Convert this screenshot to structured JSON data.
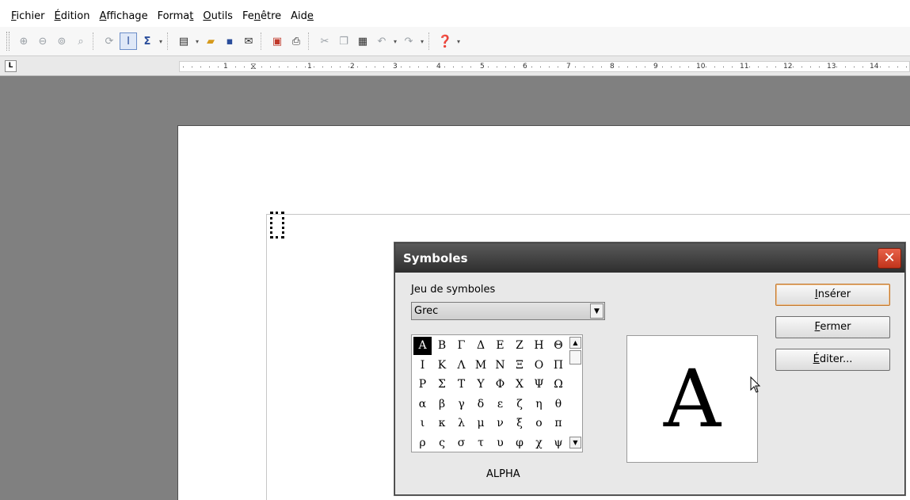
{
  "menu": [
    {
      "label": "Fichier",
      "key": "F",
      "rest": "ichier"
    },
    {
      "label": "Édition",
      "key": "É",
      "rest": "dition"
    },
    {
      "label": "Affichage",
      "key": "A",
      "rest": "ffichage"
    },
    {
      "label": "Format",
      "pre": "Forma",
      "key": "t"
    },
    {
      "label": "Outils",
      "key": "O",
      "rest": "utils"
    },
    {
      "label": "Fenêtre",
      "pre": "Fe",
      "key": "n",
      "rest": "être"
    },
    {
      "label": "Aide",
      "pre": "Aid",
      "key": "e"
    }
  ],
  "ruler": {
    "numbers": [
      "1",
      "1",
      "2",
      "3",
      "4",
      "5",
      "6",
      "7",
      "8",
      "9",
      "10",
      "11",
      "12",
      "13",
      "14"
    ]
  },
  "dialog": {
    "title": "Symboles",
    "set_label_key": "J",
    "set_label_rest": "eu de symboles",
    "selected_set": "Grec",
    "symbols": [
      [
        "Α",
        "Β",
        "Γ",
        "Δ",
        "Ε",
        "Ζ",
        "Η",
        "Θ"
      ],
      [
        "Ι",
        "Κ",
        "Λ",
        "Μ",
        "Ν",
        "Ξ",
        "Ο",
        "Π"
      ],
      [
        "Ρ",
        "Σ",
        "Τ",
        "Υ",
        "Φ",
        "Χ",
        "Ψ",
        "Ω"
      ],
      [
        "α",
        "β",
        "γ",
        "δ",
        "ε",
        "ζ",
        "η",
        "θ"
      ],
      [
        "ι",
        "κ",
        "λ",
        "μ",
        "ν",
        "ξ",
        "ο",
        "π"
      ],
      [
        "ρ",
        "ς",
        "σ",
        "τ",
        "υ",
        "φ",
        "χ",
        "ψ"
      ]
    ],
    "selected_symbol": "Α",
    "preview_symbol": "A",
    "symbol_name": "ALPHA",
    "insert_key": "I",
    "insert_rest": "nsérer",
    "close_key": "F",
    "close_rest": "ermer",
    "edit_key": "É",
    "edit_rest": "diter..."
  }
}
